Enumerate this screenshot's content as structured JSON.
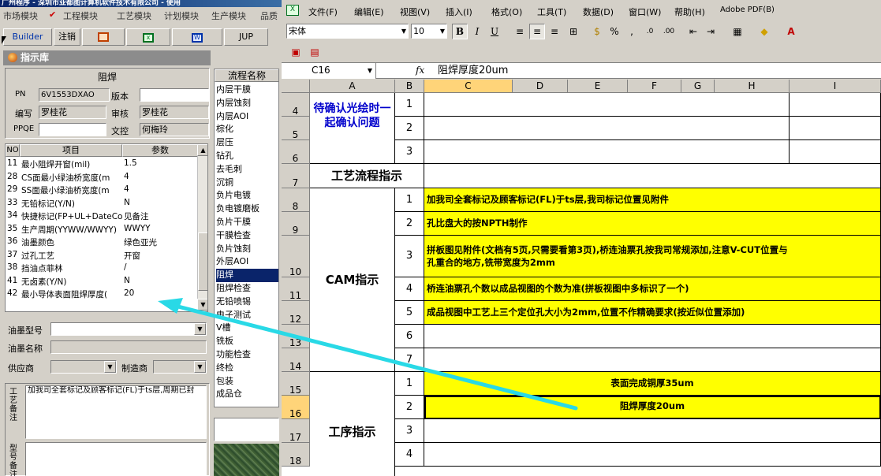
{
  "left_app": {
    "title": "广州程序 - 深圳市亚都图计算机软件技术有限公司 - 使用",
    "menu": [
      "市场模块",
      "工程模块",
      "工艺模块",
      "计划模块",
      "生产模块",
      "品质"
    ],
    "toolbar": [
      "Builder",
      "注销",
      "JUP"
    ],
    "library_title": "指示库",
    "form": {
      "title": "阻焊",
      "pn_label": "PN",
      "pn_value": "6V1553DXAO",
      "version_label": "版本",
      "version_value": "",
      "author_label": "编写",
      "author_value": "罗桂花",
      "reviewer_label": "审核",
      "reviewer_value": "罗桂花",
      "ppqe_label": "PPQE",
      "ppqe_value": "",
      "controller_label": "文控",
      "controller_value": "何梅玲"
    },
    "grid": {
      "headers": [
        "NO",
        "项目",
        "参数"
      ],
      "rows": [
        {
          "no": "11",
          "item": "最小阻焊开窗(mil)",
          "param": "1.5"
        },
        {
          "no": "28",
          "item": "CS面最小绿油桥宽度(m",
          "param": "4"
        },
        {
          "no": "29",
          "item": "SS面最小绿油桥宽度(m",
          "param": "4"
        },
        {
          "no": "33",
          "item": "无铅标记(Y/N)",
          "param": "N"
        },
        {
          "no": "34",
          "item": "快捷标记(FP+UL+DateCo",
          "param": "见备注"
        },
        {
          "no": "35",
          "item": "生产周期(YYWW/WWYY)",
          "param": "WWYY"
        },
        {
          "no": "36",
          "item": "油墨颜色",
          "param": "绿色亚光"
        },
        {
          "no": "37",
          "item": "过孔工艺",
          "param": "开窗"
        },
        {
          "no": "38",
          "item": "挡油点菲林",
          "param": "/"
        },
        {
          "no": "41",
          "item": "无卤素(Y/N)",
          "param": "N"
        },
        {
          "no": "42",
          "item": "最小导体表面阻焊厚度(",
          "param": "20"
        }
      ]
    },
    "ink_model_label": "油墨型号",
    "ink_name_label": "油墨名称",
    "supplier_label": "供应商",
    "manufacturer_label": "制造商",
    "process_note_label": "工艺备注",
    "process_note_text": "加我司全套标记及顾客标记(FL)于ts层,周期已封",
    "model_note_label": "型号备注",
    "flow": {
      "header": "流程名称",
      "items": [
        "内层干膜",
        "内层蚀刻",
        "内层AOI",
        "棕化",
        "层压",
        "钻孔",
        "去毛刺",
        "沉铜",
        "负片电镀",
        "负电镀磨板",
        "负片干膜",
        "干膜检查",
        "负片蚀刻",
        "外层AOI",
        "阻焊",
        "阻焊检查",
        "无铅喷锡",
        "电子测试",
        "V槽",
        "铣板",
        "功能检查",
        "终检",
        "包装",
        "成品仓"
      ],
      "selected": "阻焊"
    }
  },
  "excel": {
    "menu": [
      "文件(F)",
      "编辑(E)",
      "视图(V)",
      "插入(I)",
      "格式(O)",
      "工具(T)",
      "数据(D)",
      "窗口(W)",
      "帮助(H)",
      "Adobe PDF(B)"
    ],
    "font_name": "宋体",
    "font_size": "10",
    "format_buttons": [
      "B",
      "I",
      "U"
    ],
    "cell_ref": "C16",
    "fx": "fx",
    "formula": "阻焊厚度20um",
    "columns": [
      "A",
      "B",
      "C",
      "D",
      "E",
      "F",
      "G",
      "H",
      "I"
    ],
    "rows": [
      "4",
      "5",
      "6",
      "7",
      "8",
      "9",
      "10",
      "11",
      "12",
      "13",
      "14",
      "15",
      "16",
      "17",
      "18"
    ],
    "sections": {
      "confirm": "待确认光绘时一起确认问题",
      "process_flow": "工艺流程指示",
      "cam": "CAM指示",
      "procedure": "工序指示"
    },
    "nums": [
      "1",
      "2",
      "3",
      "1",
      "2",
      "3",
      "4",
      "5",
      "6",
      "7",
      "1",
      "2",
      "3",
      "4"
    ],
    "cam_items": [
      "加我司全套标记及顾客标记(FL)于ts层,我司标记位置见附件",
      "孔比盘大的按NPTH制作",
      "拼板图见附件(文档有5页,只需要看第3页),桥连油票孔按我司常规添加,注意V-CUT位置与",
      "孔重合的地方,铣带宽度为2mm",
      "桥连油票孔个数以成品视图的个数为准(拼板视图中多标识了一个)",
      "成品视图中工艺上三个定位孔大小为2mm,位置不作精确要求(按近似位置添加)"
    ],
    "procedure_items": [
      "表面完成铜厚35um",
      "阻焊厚度20um"
    ]
  },
  "colors": {
    "yellow": "#ffff00",
    "arrow": "#29d9e6",
    "selection": "#0a246a",
    "blue_text": "#0000cc"
  }
}
